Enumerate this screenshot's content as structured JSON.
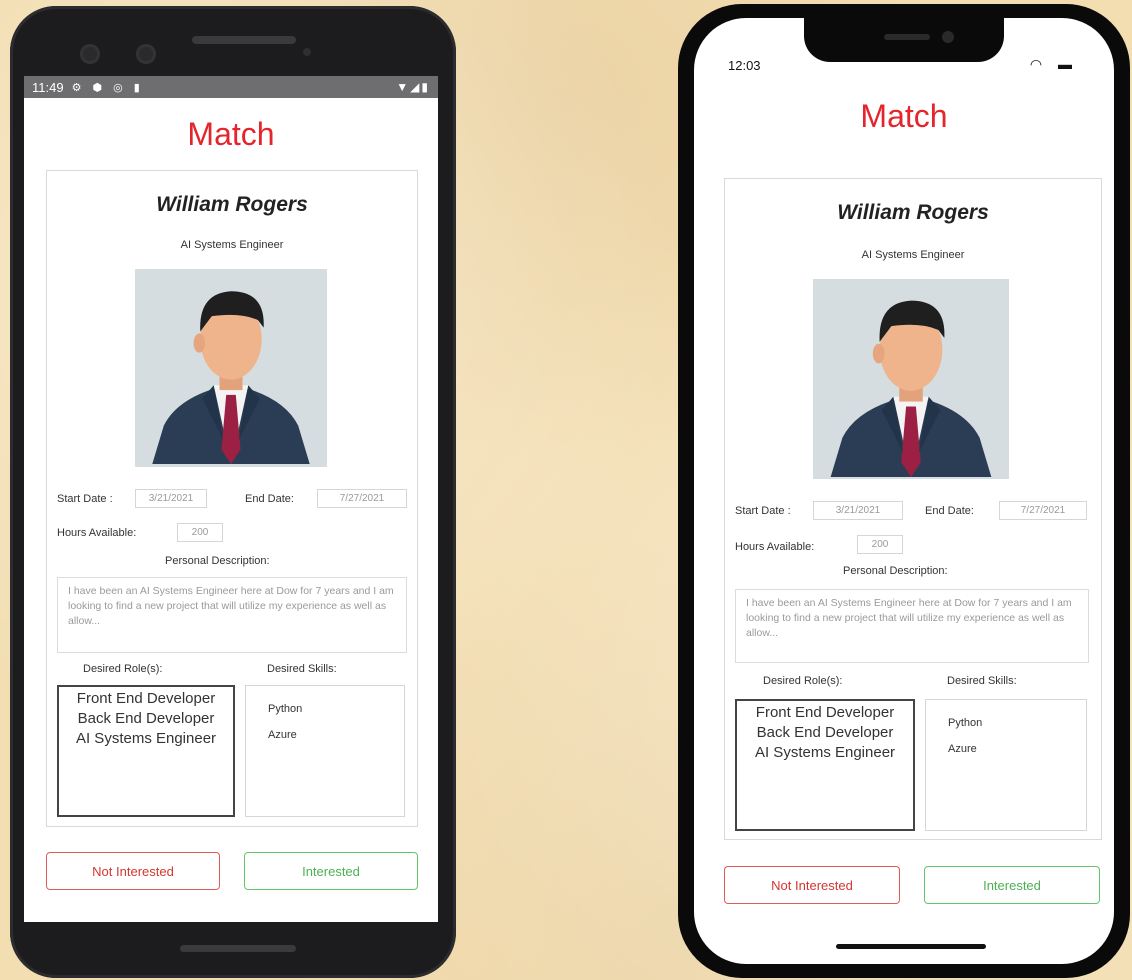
{
  "android": {
    "status": {
      "time": "11:49",
      "icons_left": "⚙ ⬢ ◎ ▮",
      "icons_right": "▼◢▮"
    }
  },
  "iphone": {
    "status": {
      "time": "12:03",
      "icons_right": "◠ ▬"
    }
  },
  "app": {
    "title": "Match",
    "candidate": {
      "name": "William Rogers",
      "role": "AI Systems Engineer"
    },
    "start_date_label": "Start Date :",
    "start_date": "3/21/2021",
    "end_date_label": "End Date:",
    "end_date": "7/27/2021",
    "hours_label": "Hours Available:",
    "hours": "200",
    "description_label": "Personal  Description:",
    "description": "I have been an AI Systems Engineer here at Dow for 7 years and I am looking to find a new project that will utilize my experience as well as allow...",
    "desired_roles_label": "Desired Role(s):",
    "desired_roles": [
      "Front End Developer",
      "Back End Developer",
      "AI Systems Engineer"
    ],
    "desired_skills_label": "Desired Skills:",
    "desired_skills": [
      "Python",
      "Azure"
    ],
    "not_interested_label": "Not Interested",
    "interested_label": "Interested"
  },
  "colors": {
    "accent_red": "#e4252b",
    "interested_green": "#4cb153",
    "background": "#f3deb2"
  }
}
